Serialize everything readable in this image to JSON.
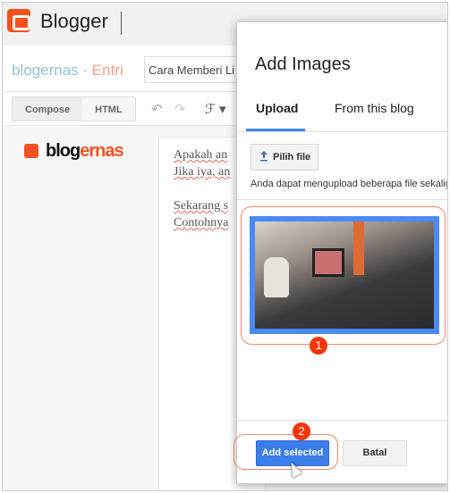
{
  "app": {
    "name": "Blogger",
    "brand_color": "#f4511e"
  },
  "breadcrumb": {
    "blog": "blogernas",
    "separator": " · ",
    "section": "Entri"
  },
  "post_title_input": {
    "value": "Cara Memberi Li"
  },
  "editor_modes": {
    "compose": "Compose",
    "html": "HTML"
  },
  "toolbar": {
    "undo": "↶",
    "redo": "↷",
    "font": "ℱ ▾"
  },
  "blog_logo": {
    "part1": "blog",
    "part2": "ernas"
  },
  "editor": {
    "lines": [
      "Apakah an",
      "Jika iya, an",
      "",
      "Sekarang s",
      "Contohnya"
    ]
  },
  "dialog": {
    "title": "Add Images",
    "tabs": [
      {
        "label": "Upload",
        "active": true
      },
      {
        "label": "From this blog",
        "active": false
      }
    ],
    "choose_file_label": "Pilih file",
    "note": "Anda dapat mengupload beberapa file sekalig",
    "image_selected": true,
    "add_selected_label": "Add selected",
    "cancel_label": "Batal",
    "accent": "#4285f4"
  },
  "annotations": {
    "step1": "1",
    "step2": "2",
    "color": "#f4360a"
  }
}
